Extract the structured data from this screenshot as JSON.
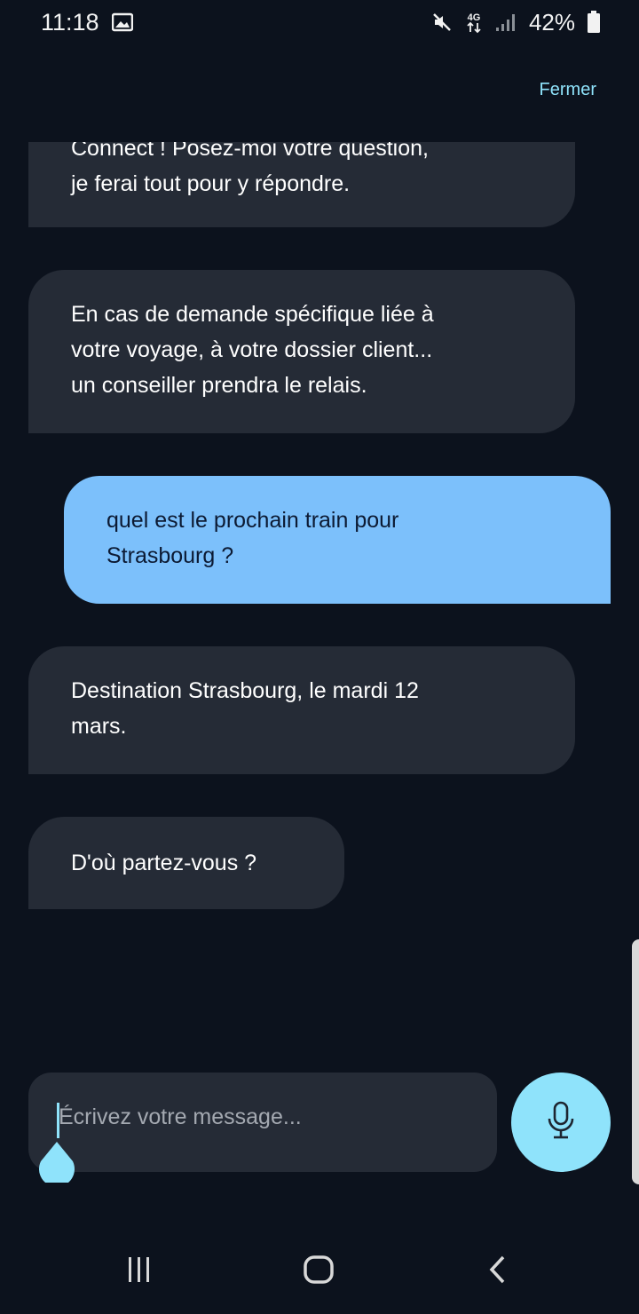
{
  "status_bar": {
    "time": "11:18",
    "network": "4G",
    "battery_percent": "42%",
    "icons": [
      "image-icon",
      "mute-icon",
      "network-4g-icon",
      "signal-icon",
      "battery-icon"
    ]
  },
  "header": {
    "close_label": "Fermer"
  },
  "messages": [
    {
      "sender": "bot",
      "text": "Connect ! Posez-moi votre question,\nje ferai tout pour y répondre."
    },
    {
      "sender": "bot",
      "text": "En cas de demande spécifique liée à\nvotre voyage, à votre dossier client...\nun conseiller prendra le relais."
    },
    {
      "sender": "user",
      "text": "quel est le prochain train pour\nStrasbourg ?"
    },
    {
      "sender": "bot",
      "text": "Destination Strasbourg, le mardi 12\nmars."
    },
    {
      "sender": "bot",
      "text": "D'où partez-vous ?"
    }
  ],
  "composer": {
    "placeholder": "Écrivez votre message...",
    "mic_icon": "microphone-icon"
  },
  "colors": {
    "background": "#0c121d",
    "bot_bubble": "#252b36",
    "user_bubble": "#7cc0fb",
    "accent": "#8fe3fb"
  },
  "nav_bar": {
    "icons": [
      "recent-apps-icon",
      "home-icon",
      "back-icon"
    ]
  }
}
